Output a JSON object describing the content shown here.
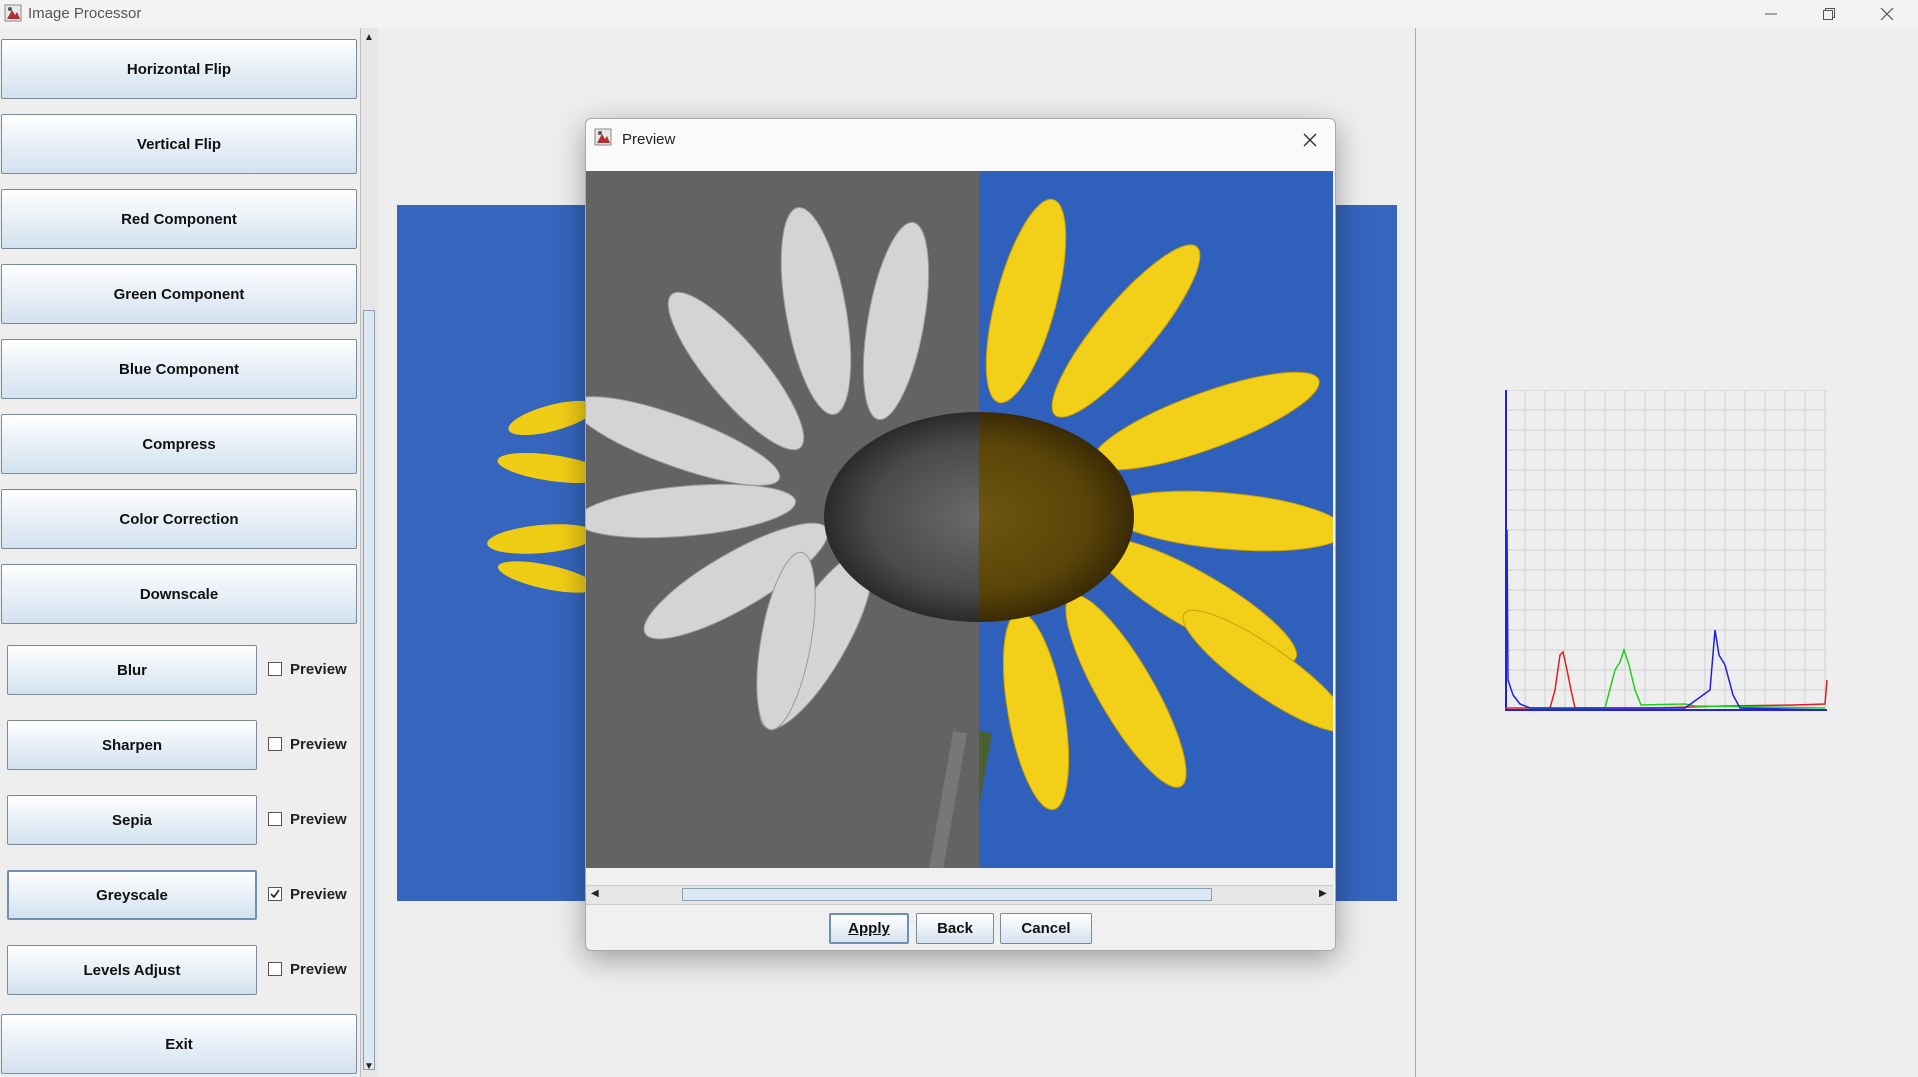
{
  "window": {
    "title": "Image Processor"
  },
  "sidebar": {
    "buttons": [
      "Horizontal Flip",
      "Vertical Flip",
      "Red Component",
      "Green Component",
      "Blue Component",
      "Compress",
      "Color Correction",
      "Downscale"
    ],
    "filters": [
      {
        "label": "Blur",
        "preview_label": "Preview",
        "checked": false
      },
      {
        "label": "Sharpen",
        "preview_label": "Preview",
        "checked": false
      },
      {
        "label": "Sepia",
        "preview_label": "Preview",
        "checked": false
      },
      {
        "label": "Greyscale",
        "preview_label": "Preview",
        "checked": true
      },
      {
        "label": "Levels Adjust",
        "preview_label": "Preview",
        "checked": false
      }
    ],
    "exit_label": "Exit"
  },
  "dialog": {
    "title": "Preview",
    "apply_label": "Apply",
    "back_label": "Back",
    "cancel_label": "Cancel"
  },
  "histogram": {
    "colors": {
      "red": "#e02020",
      "green": "#20d020",
      "blue": "#2020e0",
      "grid": "#d0d0d0"
    }
  },
  "colors": {
    "sky_blue": "#3565bd",
    "petal_yellow": "#f0cd15",
    "button_border": "#7a8a99"
  }
}
